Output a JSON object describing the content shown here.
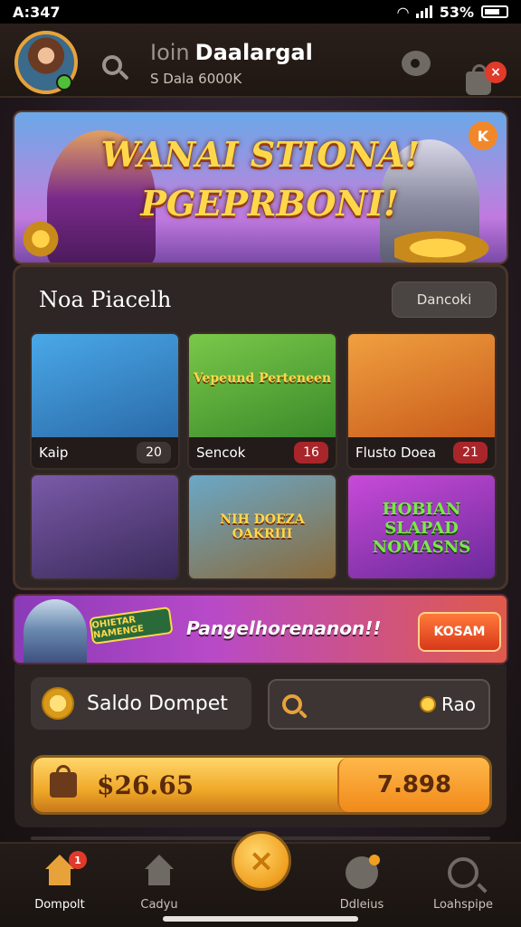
{
  "status_bar": {
    "time": "A:347",
    "battery": "53%"
  },
  "header": {
    "user_name": "Daalargal",
    "user_prefix": "Ioin",
    "user_sub": "S Dala 6000K",
    "notification_badge": "×"
  },
  "hero": {
    "title_line1": "WANAI STIONA!",
    "title_line2": "PGEPRBONI!",
    "corner_label": "K"
  },
  "games_panel": {
    "title": "Noa Piacelh",
    "button_label": "Dancoki",
    "cards": [
      {
        "name": "Kaip",
        "count": "20",
        "count_style": "dark",
        "thumb_text": "",
        "thumb_colors": [
          "#4aa8e8",
          "#2a6aa8"
        ]
      },
      {
        "name": "Sencok",
        "count": "16",
        "count_style": "red",
        "thumb_text": "Vepeund Perteneen",
        "thumb_colors": [
          "#7ac84a",
          "#3a8a2a"
        ]
      },
      {
        "name": "Flusto Doea",
        "count": "21",
        "count_style": "red",
        "thumb_text": "",
        "thumb_colors": [
          "#f0a040",
          "#c85a1a"
        ]
      },
      {
        "name": "",
        "count": "",
        "count_style": "dark",
        "thumb_text": "",
        "thumb_colors": [
          "#7a5aa8",
          "#3a2a5a"
        ]
      },
      {
        "name": "",
        "count": "",
        "count_style": "dark",
        "thumb_text": "NIH DOEZA OAKRIII",
        "thumb_colors": [
          "#6aa8c8",
          "#8a6a3a"
        ]
      },
      {
        "name": "",
        "count": "",
        "count_style": "dark",
        "thumb_text": "HOBIAN SLAPAD NOMASNS",
        "thumb_colors": [
          "#c84ad8",
          "#6a2a9a"
        ]
      }
    ]
  },
  "promo": {
    "tag": "OHIETAR NAMENGE",
    "text": "Pangelhorenanon!!",
    "button_label": "KOSAM"
  },
  "wallet": {
    "label": "Saldo Dompet",
    "search_value": "Rao",
    "balance_amount": "$26.65",
    "balance_right": "7.898"
  },
  "bottom_nav": {
    "items": [
      {
        "label": "Dompolt",
        "badge": "1"
      },
      {
        "label": "Cadyu"
      },
      {
        "label": "Ddleius"
      },
      {
        "label": "Loahspipe"
      }
    ],
    "center_symbol": "×"
  },
  "colors": {
    "accent": "#f0a020",
    "badge_red": "#e03a2a",
    "panel_bg": "#2e2624"
  }
}
